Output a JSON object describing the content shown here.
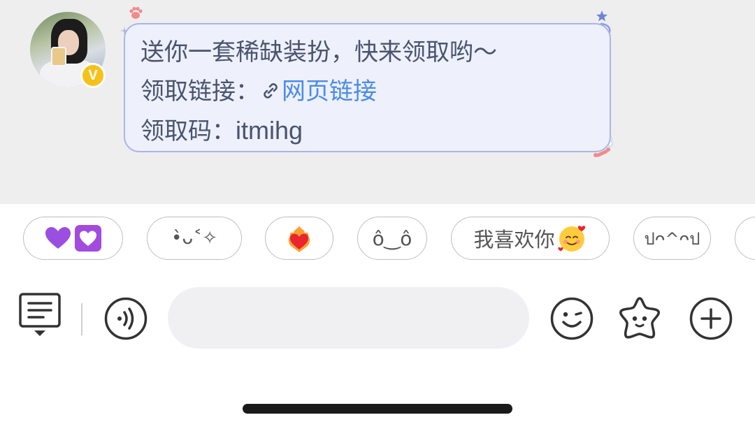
{
  "message": {
    "line1": "送你一套稀缺装扮，快来领取哟～",
    "line2_label": "领取链接：",
    "line2_link": "网页链接",
    "line3_label": "领取码：",
    "line3_code": "itmihg"
  },
  "avatar": {
    "badge_letter": "V",
    "badge_color": "#f5c21b"
  },
  "quick_replies": [
    {
      "id": "purple-hearts",
      "text": ""
    },
    {
      "id": "kaomoji-sparkle",
      "text": "•̀ᴗ˂✧"
    },
    {
      "id": "fire-heart",
      "text": ""
    },
    {
      "id": "kaomoji-face",
      "text": "ô‿ô"
    },
    {
      "id": "i-like-you",
      "text": "我喜欢你"
    },
    {
      "id": "kaomoji-happy",
      "text": "ปᴖ^ᴖป"
    }
  ],
  "input": {
    "placeholder": "",
    "value": ""
  },
  "colors": {
    "bubble_border": "#aab4e8",
    "bubble_bg": "#eef0fb",
    "text": "#49546f",
    "link": "#4a8ce6",
    "chat_bg": "#eeeeef"
  },
  "icons": {
    "toolbar_left": "message-list-icon",
    "voice": "voice-icon",
    "emoji": "smile-icon",
    "sticker": "star-face-icon",
    "more": "plus-circle-icon"
  }
}
